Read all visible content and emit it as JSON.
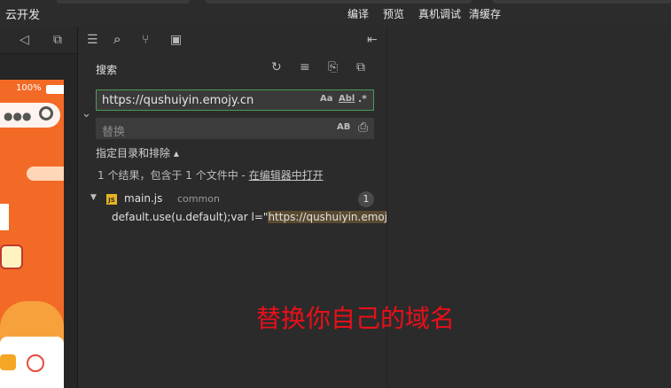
{
  "topbar": {
    "left_label": "云开发",
    "actions": [
      "编译",
      "预览",
      "真机调试",
      "清缓存"
    ]
  },
  "simulator": {
    "battery": "100%"
  },
  "search_panel": {
    "title": "搜索",
    "search_value": "https://qushuiyin.emojy.cn",
    "search_options": [
      "Aa",
      "Abl",
      ".*"
    ],
    "replace_placeholder": "替换",
    "replace_option": "AB",
    "include_exclude_label": "指定目录和排除 ▴",
    "results_summary": "1 个结果，包含于 1 个文件中 - ",
    "open_in_editor": "在编辑器中打开",
    "file": {
      "name": "main.js",
      "folder": "common",
      "count": "1",
      "match_prefix": "default.use(u.default);var l=\"",
      "match_text": "https://qushuiyin.emojy..."
    }
  },
  "annotation": "替换你自己的域名",
  "colors": {
    "accent_border": "#4e9a55",
    "annotation_red": "#e8101a",
    "sim_orange": "#f26a26"
  }
}
